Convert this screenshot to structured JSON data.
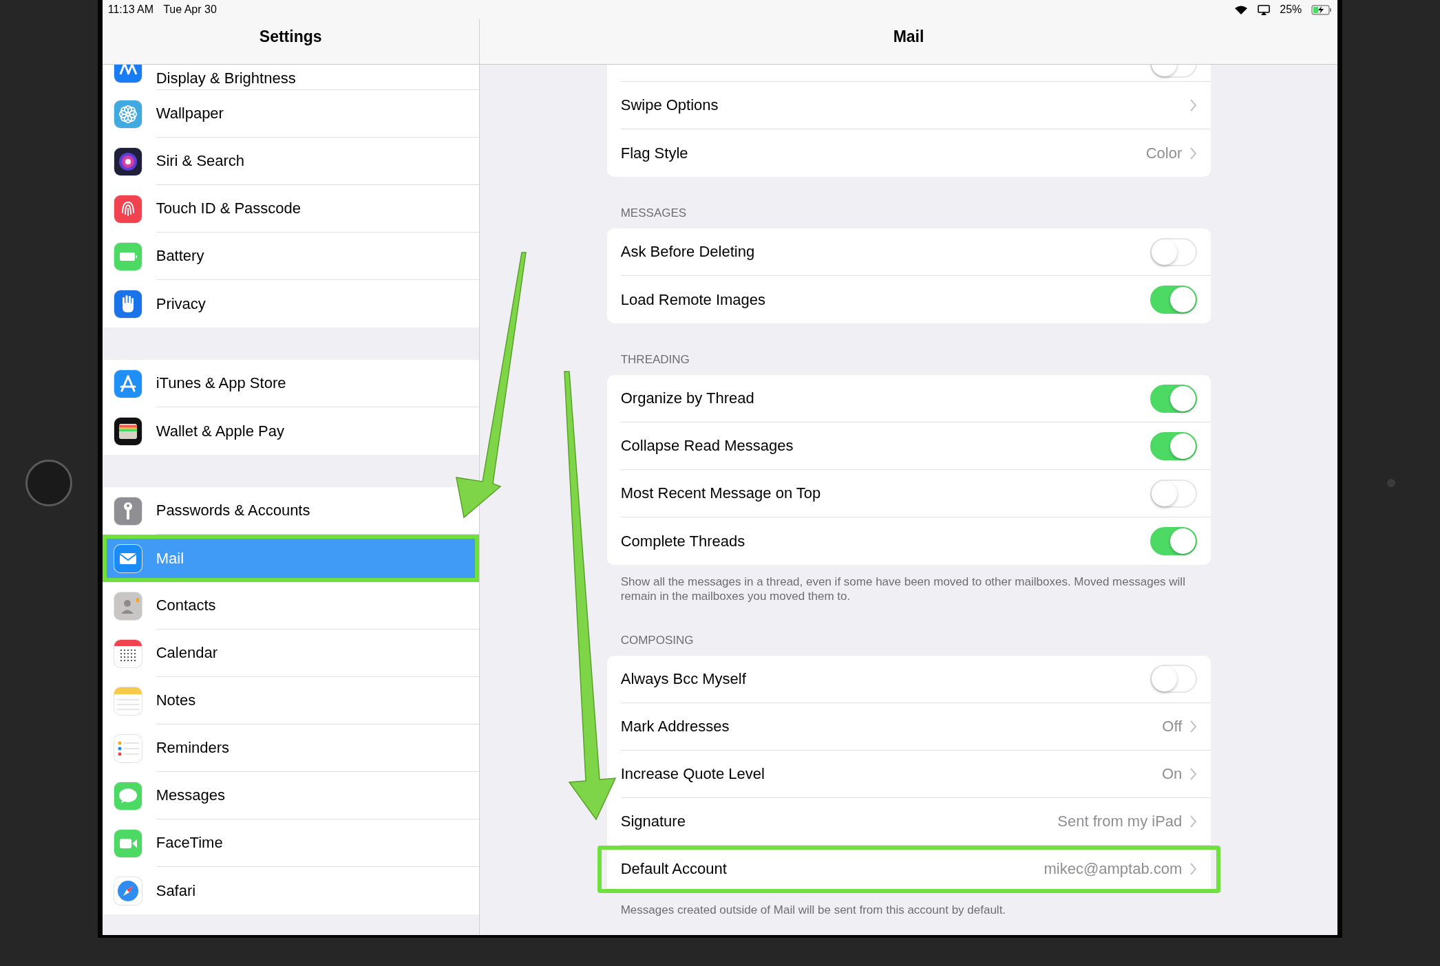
{
  "status_bar": {
    "time": "11:13 AM",
    "date": "Tue Apr 30",
    "battery_percent": "25%"
  },
  "sidebar": {
    "title": "Settings",
    "groups": [
      {
        "items": [
          {
            "label": "Display & Brightness",
            "selected": false,
            "highlighted": false
          },
          {
            "label": "Wallpaper",
            "selected": false,
            "highlighted": false
          },
          {
            "label": "Siri & Search",
            "selected": false,
            "highlighted": false
          },
          {
            "label": "Touch ID & Passcode",
            "selected": false,
            "highlighted": false
          },
          {
            "label": "Battery",
            "selected": false,
            "highlighted": false
          },
          {
            "label": "Privacy",
            "selected": false,
            "highlighted": false
          }
        ]
      },
      {
        "items": [
          {
            "label": "iTunes & App Store",
            "selected": false,
            "highlighted": false
          },
          {
            "label": "Wallet & Apple Pay",
            "selected": false,
            "highlighted": false
          }
        ]
      },
      {
        "items": [
          {
            "label": "Passwords & Accounts",
            "selected": false,
            "highlighted": false
          },
          {
            "label": "Mail",
            "selected": true,
            "highlighted": true
          },
          {
            "label": "Contacts",
            "selected": false,
            "highlighted": false
          },
          {
            "label": "Calendar",
            "selected": false,
            "highlighted": false
          },
          {
            "label": "Notes",
            "selected": false,
            "highlighted": false
          },
          {
            "label": "Reminders",
            "selected": false,
            "highlighted": false
          },
          {
            "label": "Messages",
            "selected": false,
            "highlighted": false
          },
          {
            "label": "FaceTime",
            "selected": false,
            "highlighted": false
          },
          {
            "label": "Safari",
            "selected": false,
            "highlighted": false
          }
        ]
      }
    ]
  },
  "detail": {
    "title": "Mail",
    "sections": [
      {
        "rows": [
          {
            "kind": "toggle",
            "on": false,
            "highlighted": false
          },
          {
            "kind": "link",
            "label": "Swipe Options",
            "highlighted": false
          },
          {
            "kind": "link",
            "label": "Flag Style",
            "value": "Color",
            "highlighted": false
          }
        ]
      },
      {
        "header": "MESSAGES",
        "rows": [
          {
            "kind": "toggle",
            "label": "Ask Before Deleting",
            "on": false,
            "highlighted": false
          },
          {
            "kind": "toggle",
            "label": "Load Remote Images",
            "on": true,
            "highlighted": false
          }
        ]
      },
      {
        "header": "THREADING",
        "rows": [
          {
            "kind": "toggle",
            "label": "Organize by Thread",
            "on": true,
            "highlighted": false
          },
          {
            "kind": "toggle",
            "label": "Collapse Read Messages",
            "on": true,
            "highlighted": false
          },
          {
            "kind": "toggle",
            "label": "Most Recent Message on Top",
            "on": false,
            "highlighted": false
          },
          {
            "kind": "toggle",
            "label": "Complete Threads",
            "on": true,
            "highlighted": false
          }
        ],
        "footer": "Show all the messages in a thread, even if some have been moved to other mailboxes. Moved messages will remain in the mailboxes you moved them to."
      },
      {
        "header": "COMPOSING",
        "rows": [
          {
            "kind": "toggle",
            "label": "Always Bcc Myself",
            "on": false,
            "highlighted": false
          },
          {
            "kind": "link",
            "label": "Mark Addresses",
            "value": "Off",
            "highlighted": false
          },
          {
            "kind": "link",
            "label": "Increase Quote Level",
            "value": "On",
            "highlighted": false
          },
          {
            "kind": "link",
            "label": "Signature",
            "value": "Sent from my iPad",
            "highlighted": false
          },
          {
            "kind": "link",
            "label": "Default Account",
            "value": "mikec@amptab.com",
            "highlighted": true
          }
        ],
        "footer": "Messages created outside of Mail will be sent from this account by default."
      }
    ]
  }
}
